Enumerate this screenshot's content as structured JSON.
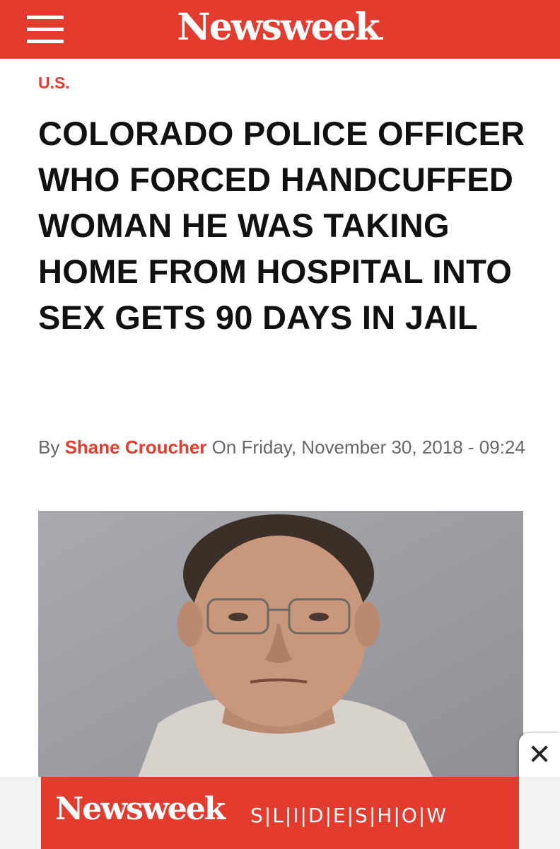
{
  "header": {
    "logo_text": "Newsweek",
    "brand_color": "#e33b2e"
  },
  "article": {
    "section": "U.S.",
    "headline": "COLORADO POLICE OFFICER WHO FORCED HANDCUFFED WOMAN HE WAS TAKING HOME FROM HOSPITAL INTO SEX GETS 90 DAYS IN JAIL",
    "byline": {
      "prefix": "By",
      "author": "Shane Croucher",
      "date_text": "On Friday, November 30, 2018 - 09:24"
    }
  },
  "ad": {
    "logo_text": "Newsweek",
    "slideshow_text": "S|L|I|D|E|S|H|O|W",
    "close_icon": "close-icon"
  }
}
